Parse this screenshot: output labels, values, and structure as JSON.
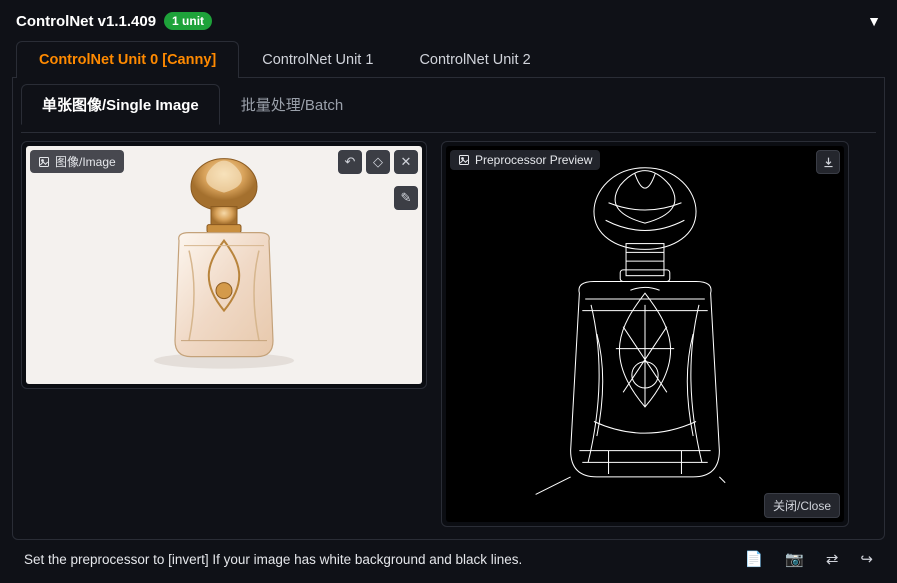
{
  "header": {
    "title": "ControlNet v1.1.409",
    "badge": "1 unit"
  },
  "unit_tabs": [
    {
      "label": "ControlNet Unit 0 [Canny]",
      "active": true
    },
    {
      "label": "ControlNet Unit 1",
      "active": false
    },
    {
      "label": "ControlNet Unit 2",
      "active": false
    }
  ],
  "mode_tabs": [
    {
      "label": "单张图像/Single Image",
      "active": true
    },
    {
      "label": "批量处理/Batch",
      "active": false
    }
  ],
  "image_panel": {
    "label": "图像/Image"
  },
  "preview_panel": {
    "label": "Preprocessor Preview",
    "close_label": "关闭/Close"
  },
  "footer": {
    "hint": "Set the preprocessor to [invert] If your image has white background and black lines."
  }
}
